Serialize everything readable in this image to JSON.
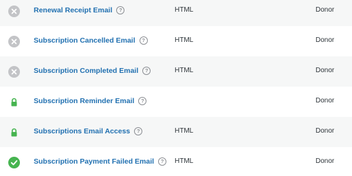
{
  "emails": [
    {
      "status": "disabled",
      "status_icon": "x-circle-icon",
      "name": "Renewal Receipt Email",
      "content_type": "HTML",
      "recipient": "Donor"
    },
    {
      "status": "disabled",
      "status_icon": "x-circle-icon",
      "name": "Subscription Cancelled Email",
      "content_type": "HTML",
      "recipient": "Donor"
    },
    {
      "status": "disabled",
      "status_icon": "x-circle-icon",
      "name": "Subscription Completed Email",
      "content_type": "HTML",
      "recipient": "Donor"
    },
    {
      "status": "locked",
      "status_icon": "lock-icon",
      "name": "Subscription Reminder Email",
      "content_type": "",
      "recipient": "Donor"
    },
    {
      "status": "locked",
      "status_icon": "lock-icon",
      "name": "Subscriptions Email Access",
      "content_type": "HTML",
      "recipient": "Donor"
    },
    {
      "status": "enabled",
      "status_icon": "check-circle-icon",
      "name": "Subscription Payment Failed Email",
      "content_type": "HTML",
      "recipient": "Donor"
    }
  ],
  "help_glyph": "?",
  "colors": {
    "link": "#2271b1",
    "disabled_icon": "#c3c4c7",
    "lock_icon": "#46b450",
    "enabled_icon": "#46b450",
    "alt_row": "#f6f7f7"
  }
}
